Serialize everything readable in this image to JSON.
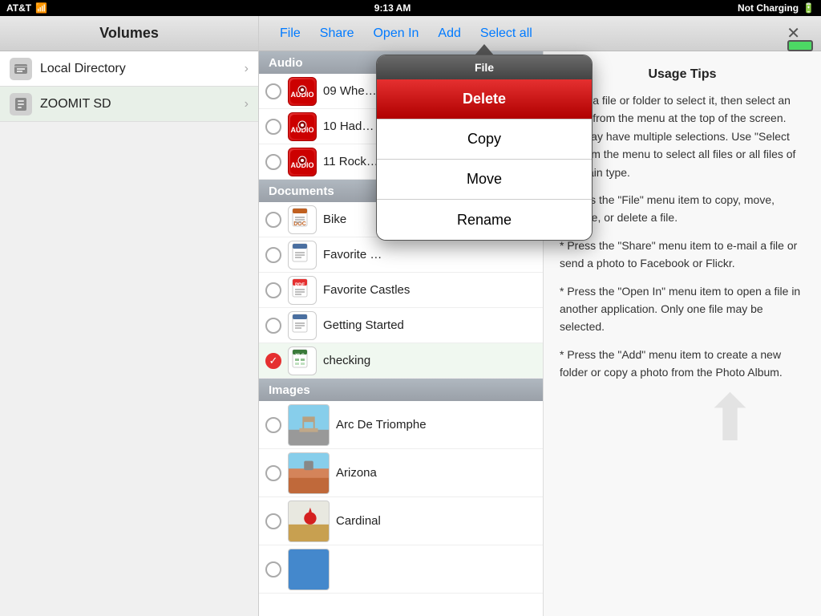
{
  "statusBar": {
    "carrier": "AT&T",
    "time": "9:13 AM",
    "batteryStatus": "Not Charging"
  },
  "sidebar": {
    "title": "Volumes",
    "items": [
      {
        "id": "local-directory",
        "label": "Local Directory",
        "icon": "📋",
        "active": false
      },
      {
        "id": "zoomit-sd",
        "label": "ZOOMIT SD",
        "icon": "💾",
        "active": true
      }
    ]
  },
  "toolbar": {
    "file_label": "File",
    "share_label": "Share",
    "openIn_label": "Open In",
    "add_label": "Add",
    "selectAll_label": "Select all",
    "close_label": "✕"
  },
  "fileList": {
    "sections": [
      {
        "id": "audio",
        "header": "Audio",
        "files": [
          {
            "id": "audio1",
            "name": "09 Whe…",
            "type": "audio",
            "checked": false
          },
          {
            "id": "audio2",
            "name": "10 Had…",
            "type": "audio",
            "checked": false
          },
          {
            "id": "audio3",
            "name": "11 Rock…",
            "type": "audio",
            "checked": false
          }
        ]
      },
      {
        "id": "documents",
        "header": "Documents",
        "files": [
          {
            "id": "doc1",
            "name": "Bike",
            "type": "doc",
            "checked": false
          },
          {
            "id": "doc2",
            "name": "Favorite …",
            "type": "doc",
            "checked": false
          },
          {
            "id": "doc3",
            "name": "Favorite Castles",
            "type": "pdf",
            "checked": false
          },
          {
            "id": "doc4",
            "name": "Getting Started",
            "type": "doc",
            "checked": false
          },
          {
            "id": "doc5",
            "name": "checking",
            "type": "xls",
            "checked": true
          }
        ]
      },
      {
        "id": "images",
        "header": "Images",
        "files": [
          {
            "id": "img1",
            "name": "Arc De Triomphe",
            "type": "img",
            "thumb": "arc",
            "checked": false
          },
          {
            "id": "img2",
            "name": "Arizona",
            "type": "img",
            "thumb": "arizona",
            "checked": false
          },
          {
            "id": "img3",
            "name": "Cardinal",
            "type": "img",
            "thumb": "cardinal",
            "checked": false
          }
        ]
      }
    ]
  },
  "usageTips": {
    "title": "Usage Tips",
    "tips": [
      "Touch a file or folder to select it, then select an action from the menu at the top of the screen. You may have multiple selections. Use \"Select all\" from the menu to select all files or all files of a certain type.",
      "* Press the \"File\" menu item to copy, move, rename, or delete a file.",
      "* Press the \"Share\" menu item to e-mail a file or send a photo to Facebook or Flickr.",
      "* Press the \"Open In\" menu item to open a file in another application. Only one file may be selected.",
      "* Press the \"Add\" menu item to create a new folder or copy a photo from the Photo Album."
    ]
  },
  "popup": {
    "title": "File",
    "buttons": [
      {
        "id": "delete",
        "label": "Delete",
        "style": "delete"
      },
      {
        "id": "copy",
        "label": "Copy",
        "style": "normal"
      },
      {
        "id": "move",
        "label": "Move",
        "style": "normal"
      },
      {
        "id": "rename",
        "label": "Rename",
        "style": "normal"
      }
    ]
  }
}
